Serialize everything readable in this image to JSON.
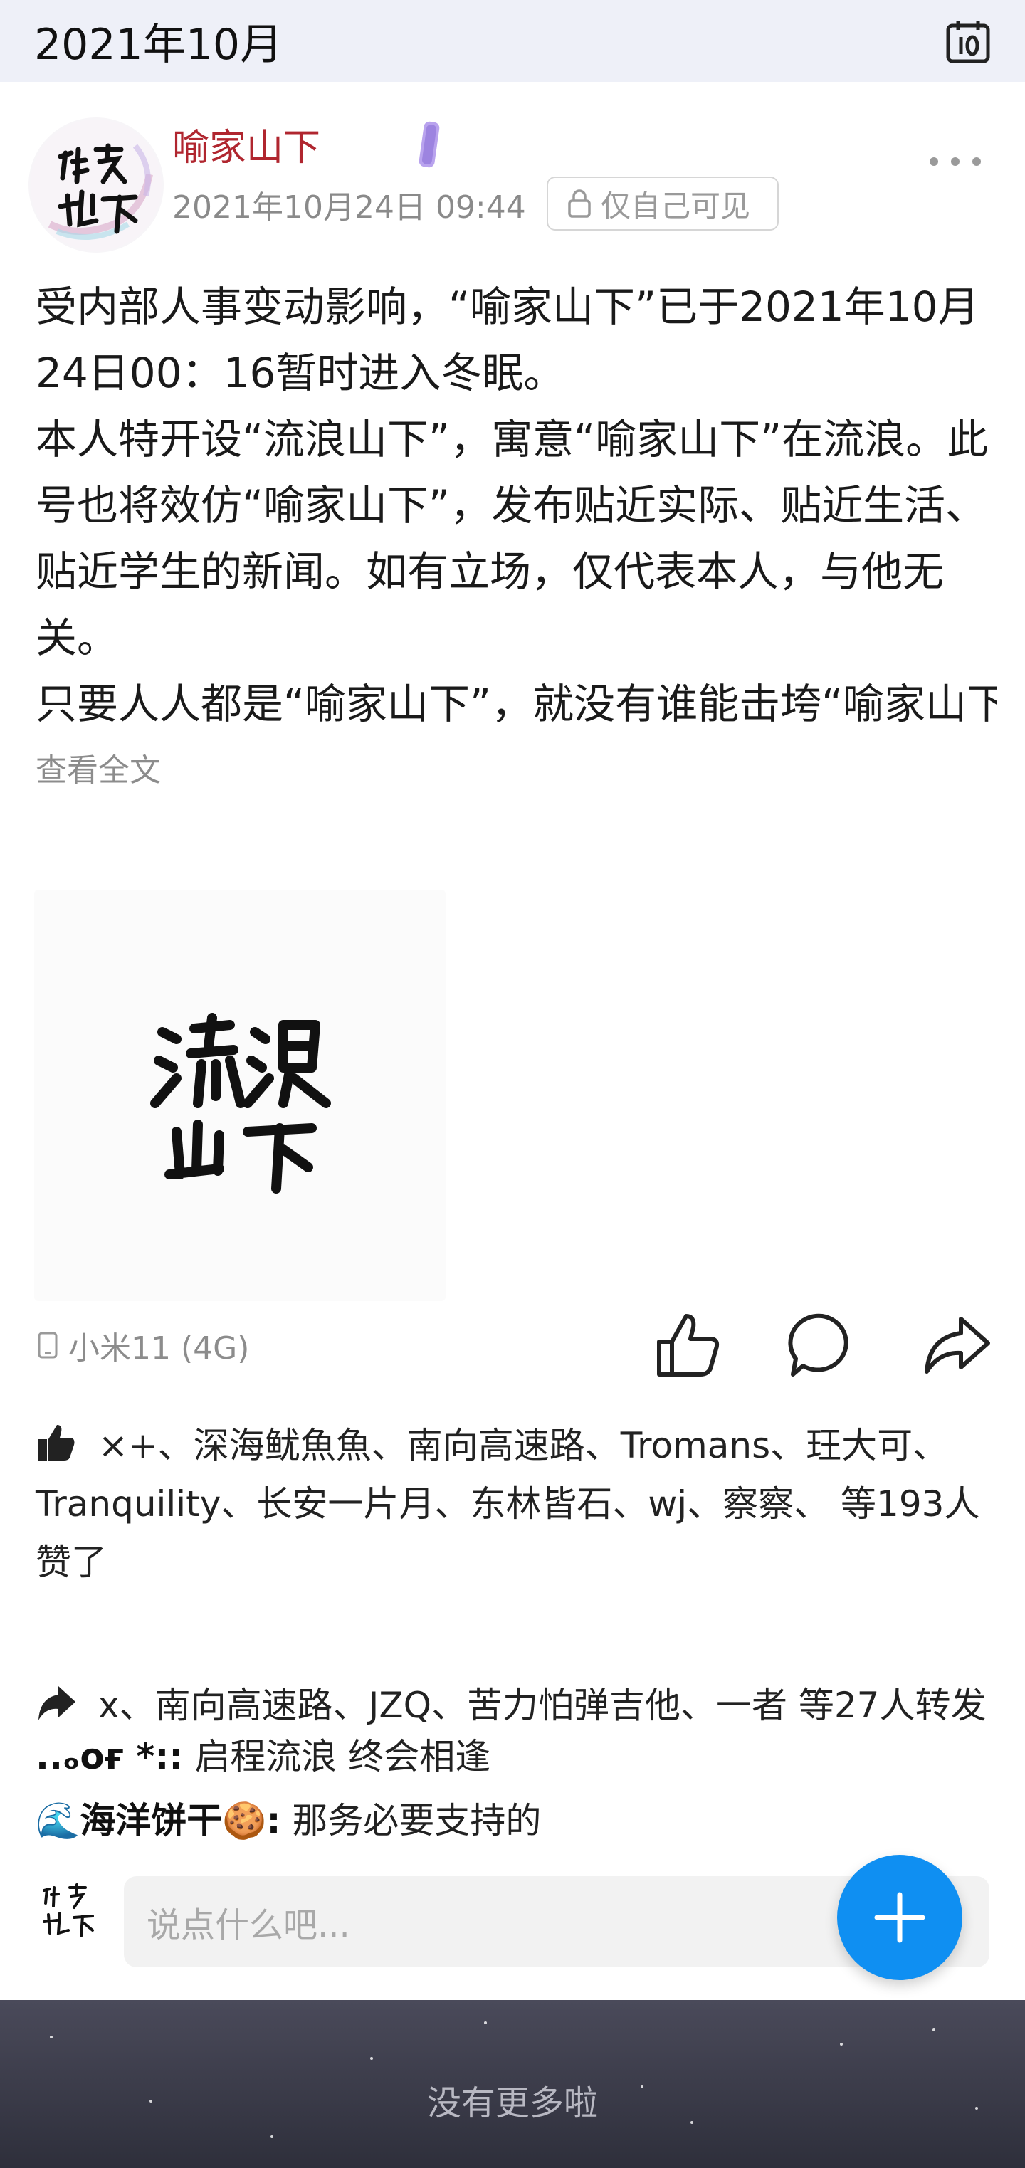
{
  "header": {
    "month": "2021年10月",
    "calendar_icon": "calendar-icon"
  },
  "post": {
    "author": "喻家山下",
    "avatar_text": "喻家山下",
    "time": "2021年10月24日 09:44",
    "privacy": "仅自己可见",
    "paragraphs": [
      "受内部人事变动影响，“喻家山下”已于2021年10月24日00：16暂时进入冬眠。",
      "本人特开设“流浪山下”，寓意“喻家山下”在流浪。此号也将效仿“喻家山下”，发布贴近实际、贴近生活、贴近学生的新闻。如有立场，仅代表本人，与他无关。",
      "只要人人都是“喻家山下”，就没有谁能击垮“喻家山下”。正如海子在《以梦为马》中写道：“..."
    ],
    "read_more": "查看全文",
    "image_text": "流浪山下",
    "device": "小米11 (4G)",
    "likes_text": "×+、深海鱿魚魚、南向高速路、Tromans、玨大可、Tranquility、长安一片月、东林皆石、wj、察察、 等193人赞了",
    "reposts_text": "x、南向高速路、JZQ、苦力怕弹吉他、一者 等27人转发",
    "comments": [
      {
        "name": "..ₒoғ *::",
        "text": "启程流浪 终会相逢"
      },
      {
        "name": "🌊海洋饼干🍪:",
        "text": "那务必要支持的"
      }
    ]
  },
  "reply": {
    "placeholder": "说点什么吧..."
  },
  "footer": {
    "text": "没有更多啦"
  },
  "colors": {
    "accent": "#0f8ff2",
    "author": "#b0262f"
  }
}
